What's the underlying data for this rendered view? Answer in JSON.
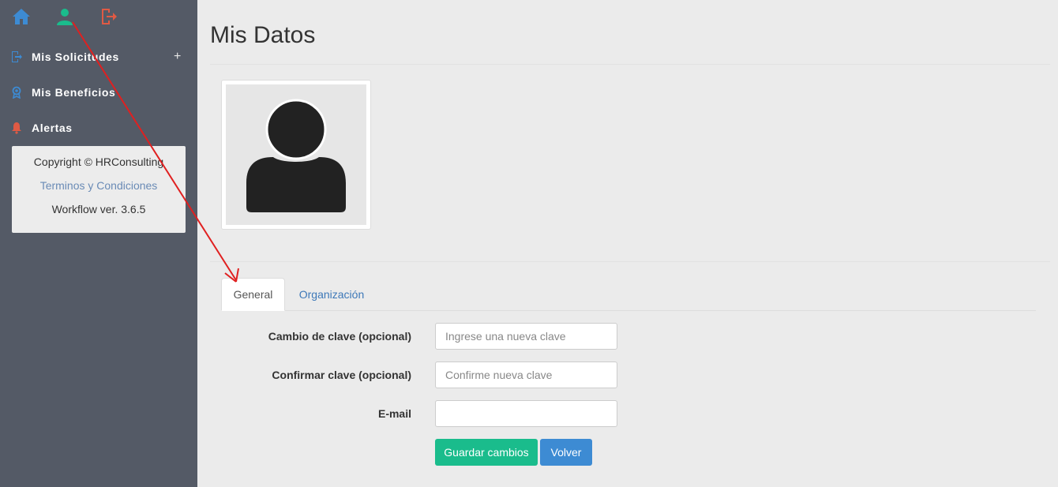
{
  "sidebar": {
    "nav": [
      {
        "label": "Mis Solicitudes",
        "icon": "logout-doc-icon",
        "has_plus": true,
        "plus": "+"
      },
      {
        "label": "Mis Beneficios",
        "icon": "award-icon"
      },
      {
        "label": "Alertas",
        "icon": "bell-icon"
      }
    ],
    "info": {
      "copyright": "Copyright © HRConsulting",
      "terms": "Terminos y Condiciones",
      "version": "Workflow ver. 3.6.5"
    }
  },
  "main": {
    "title": "Mis Datos",
    "tabs": [
      {
        "label": "General",
        "active": true
      },
      {
        "label": "Organización",
        "active": false
      }
    ],
    "form": {
      "password_label": "Cambio de clave (opcional)",
      "password_placeholder": "Ingrese una nueva clave",
      "confirm_label": "Confirmar clave (opcional)",
      "confirm_placeholder": "Confirme nueva clave",
      "email_label": "E-mail",
      "email_value": ""
    },
    "buttons": {
      "save": "Guardar cambios",
      "back": "Volver"
    }
  },
  "colors": {
    "sidebar_bg": "#545a66",
    "home_icon": "#3d8bd3",
    "user_icon": "#1abc8c",
    "logout_icon": "#e05a44",
    "save_button": "#1abc8c",
    "back_button": "#3d8bd3",
    "annotation_arrow": "#e02020"
  }
}
